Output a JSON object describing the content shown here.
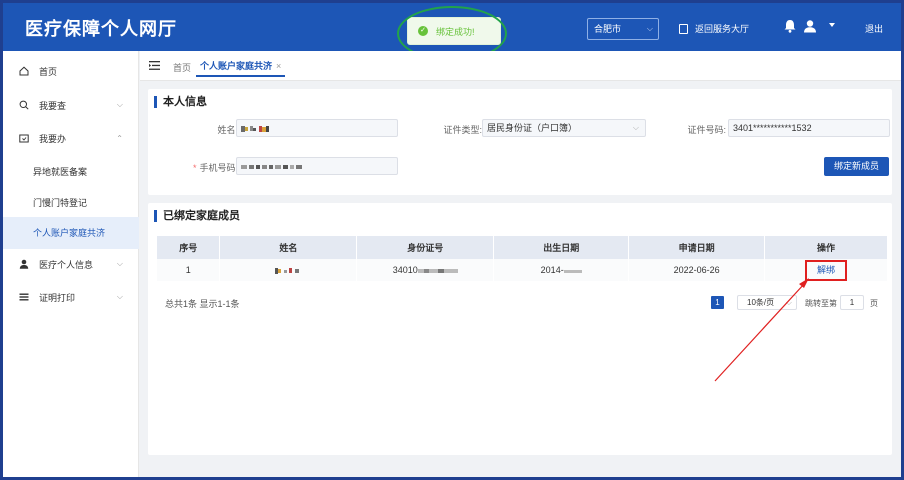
{
  "header": {
    "app_title": "医疗保障个人网厅",
    "toast": "绑定成功!",
    "city": "合肥市",
    "back_label": "返回服务大厅",
    "logout_label": "退出"
  },
  "sidebar": {
    "items": [
      {
        "label": "首页",
        "icon": "home-icon"
      },
      {
        "label": "我要查",
        "icon": "search-icon"
      },
      {
        "label": "我要办",
        "icon": "folder-icon"
      },
      {
        "label": "医疗个人信息",
        "icon": "person-icon"
      },
      {
        "label": "证明打印",
        "icon": "list-icon"
      }
    ],
    "sub_items": [
      "异地就医备案",
      "门慢门特登记",
      "个人账户家庭共济"
    ]
  },
  "tabs": {
    "home": "首页",
    "current": "个人账户家庭共济",
    "close": "×"
  },
  "personal": {
    "title": "本人信息",
    "name_label": "姓名:",
    "id_type_label": "证件类型:",
    "id_type_value": "居民身份证（户口簿）",
    "id_no_label": "证件号码:",
    "id_no_value": "3401***********1532",
    "phone_label": "手机号码:",
    "phone_required": "*",
    "bind_button": "绑定新成员"
  },
  "family": {
    "title": "已绑定家庭成员",
    "columns": [
      "序号",
      "姓名",
      "身份证号",
      "出生日期",
      "申请日期",
      "操作"
    ],
    "rows": [
      {
        "index": "1",
        "id_visible": "34010",
        "birth_visible": "2014-",
        "apply_date": "2022-06-26",
        "action": "解绑"
      }
    ],
    "total": "总共1条 显示1-1条",
    "page": "1",
    "page_size": "10条/页",
    "goto_label": "跳转至第",
    "goto_value": "1",
    "page_suffix": "页"
  },
  "colors": {
    "primary": "#1d56b6",
    "success": "#67c23a",
    "highlight_box": "#e02020",
    "annotation_oval": "#22a34a"
  }
}
